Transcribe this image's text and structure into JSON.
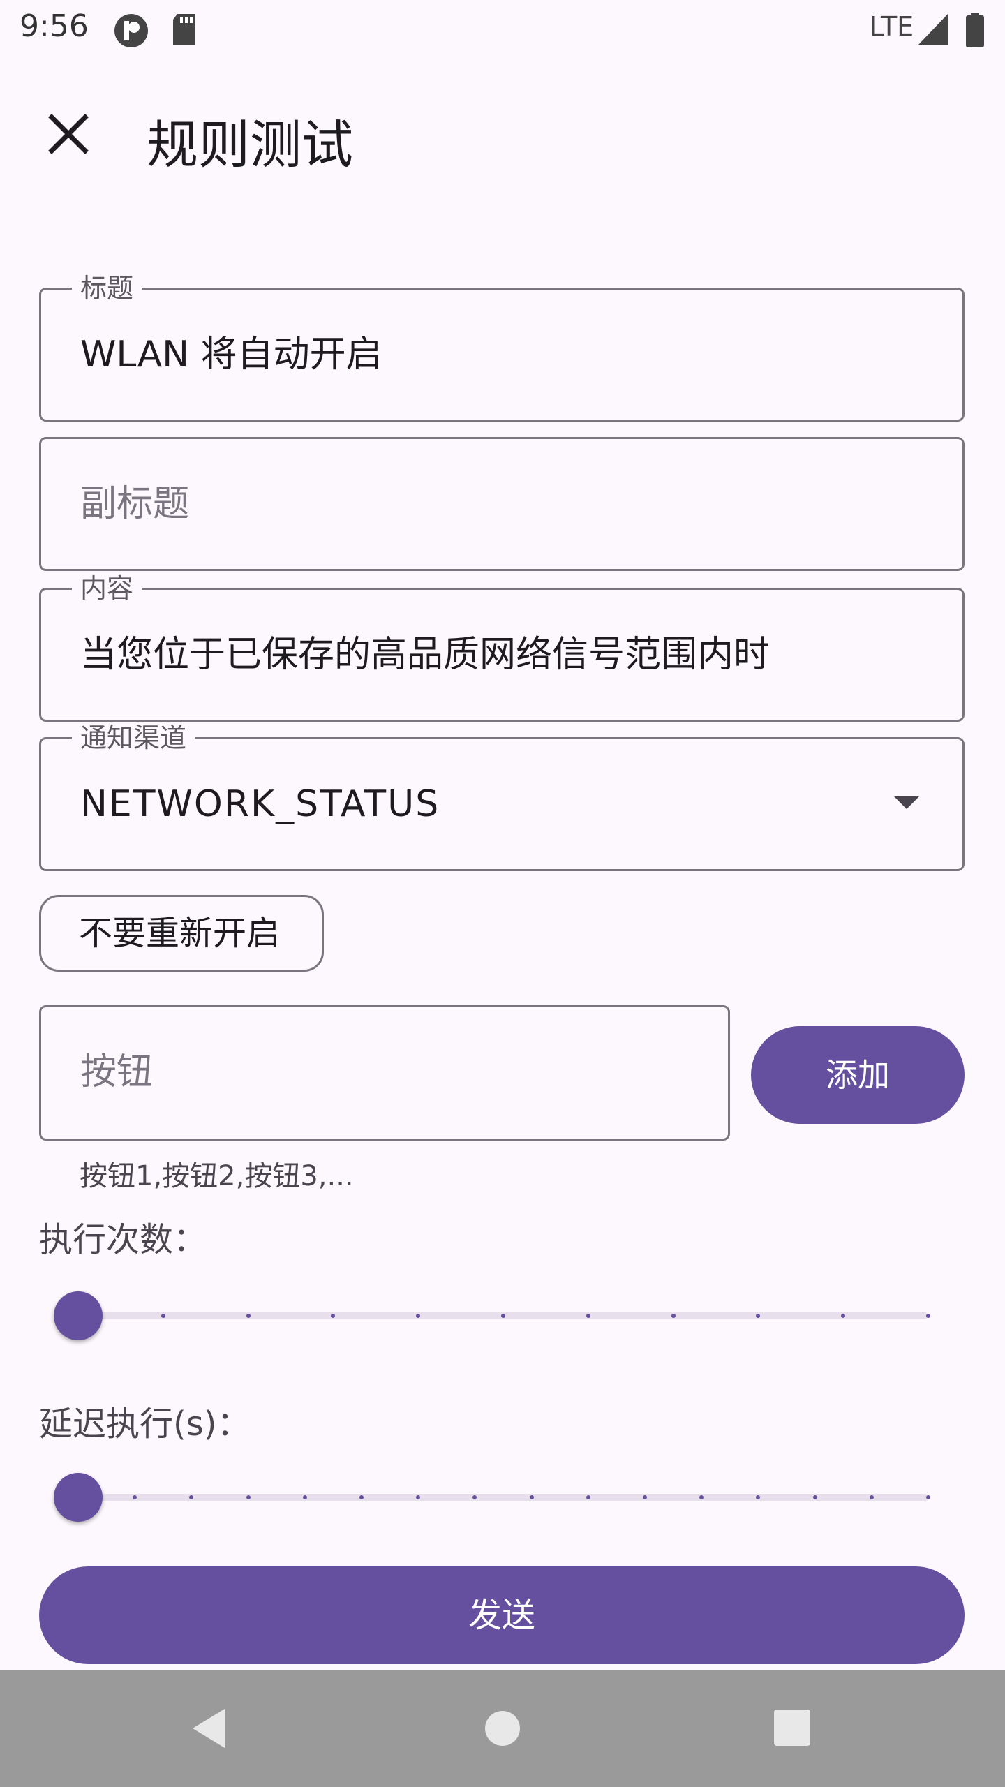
{
  "status_bar": {
    "time": "9:56",
    "network": "LTE",
    "icons": [
      "app-icon",
      "sd-card-icon",
      "signal-icon",
      "battery-icon"
    ]
  },
  "app_bar": {
    "title": "规则测试",
    "close_icon": "close-icon"
  },
  "form": {
    "title_field": {
      "label": "标题",
      "value": "WLAN 将自动开启"
    },
    "subtitle_field": {
      "placeholder": "副标题",
      "value": ""
    },
    "content_field": {
      "label": "内容",
      "value": "当您位于已保存的高品质网络信号范围内时"
    },
    "channel_field": {
      "label": "通知渠道",
      "value": "NETWORK_STATUS"
    },
    "chip": {
      "label": "不要重新开启"
    },
    "button_field": {
      "placeholder": "按钮",
      "helper": "按钮1,按钮2,按钮3,..."
    },
    "add_button": {
      "label": "添加"
    },
    "exec_count": {
      "label": "执行次数：",
      "value": 0,
      "steps": 10
    },
    "delay": {
      "label": "延迟执行(s)：",
      "value": 0,
      "steps": 15
    },
    "send_button": {
      "label": "发送"
    }
  },
  "colors": {
    "primary": "#65509f",
    "background": "#fdf8fd",
    "outline": "#79747e",
    "nav_bar": "#9a9a9a"
  },
  "nav_bar": {
    "icons": [
      "back-icon",
      "home-icon",
      "recents-icon"
    ]
  }
}
